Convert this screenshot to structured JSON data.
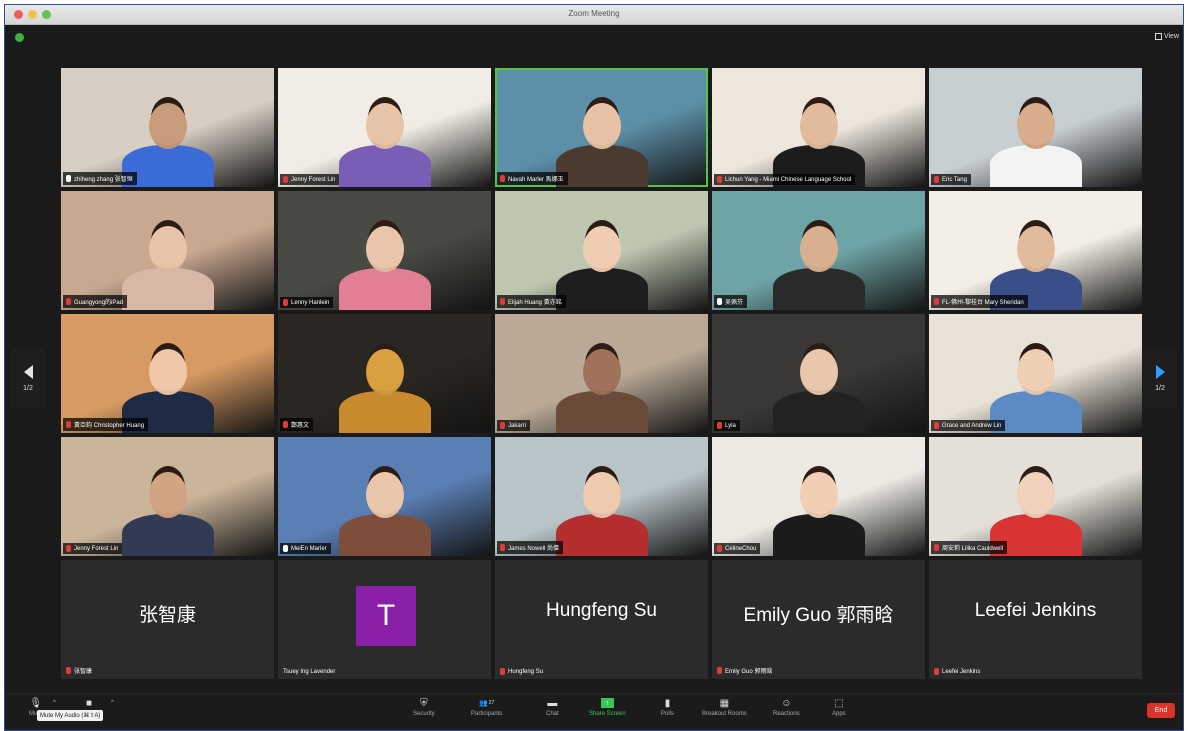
{
  "window": {
    "title": "Zoom Meeting"
  },
  "view": {
    "label": "View"
  },
  "pager": {
    "left": "1/2",
    "right": "1/2"
  },
  "participants": [
    {
      "name": "zhiheng zhang 张智恒",
      "muted": false,
      "bg": "#d8cfc4",
      "skin": "#c89b7b",
      "shirt": "#3b6bd6"
    },
    {
      "name": "Jenny Forest Lin",
      "muted": true,
      "bg": "#f1ede6",
      "skin": "#e6c4a8",
      "shirt": "#7a5db6"
    },
    {
      "name": "Navah Marler 馬娜玉",
      "muted": true,
      "bg": "#5c8fa8",
      "skin": "#e8c2a6",
      "shirt": "#4b3a2f",
      "active": true
    },
    {
      "name": "Lichun Yang - Miami Chinese Language School",
      "muted": true,
      "bg": "#ece6dc",
      "skin": "#e2bb9c",
      "shirt": "#1c1c1c"
    },
    {
      "name": "Eric Tang",
      "muted": true,
      "bg": "#c8cfd3",
      "skin": "#d9ad8b",
      "shirt": "#f3f3f3"
    },
    {
      "name": "Guangyong的iPad",
      "muted": true,
      "bg": "#c9a890",
      "skin": "#e7c3a7",
      "shirt": "#d8b7a6"
    },
    {
      "name": "Lenny Hanlein",
      "muted": true,
      "bg": "#4a4a45",
      "skin": "#eac5ab",
      "shirt": "#e27f95"
    },
    {
      "name": "Elijah Huang 黃亦銘",
      "muted": true,
      "bg": "#bdc7b0",
      "skin": "#f0cdb2",
      "shirt": "#1e1e1e"
    },
    {
      "name": "吴佩芬",
      "muted": false,
      "bg": "#6fa4a6",
      "skin": "#d8b090",
      "shirt": "#2a2a2a"
    },
    {
      "name": "FL-佛州-黎桂台 Mary Sheridan",
      "muted": true,
      "bg": "#f4efe6",
      "skin": "#e1bb9c",
      "shirt": "#3a4f8a"
    },
    {
      "name": "黃亞鈞 Christopher Huang",
      "muted": true,
      "bg": "#d79a62",
      "skin": "#f0c8a8",
      "shirt": "#1f2a44"
    },
    {
      "name": "鄭惠文",
      "muted": true,
      "bg": "#2a2622",
      "skin": "#d9a040",
      "shirt": "#c98a2e"
    },
    {
      "name": "Jakarri",
      "muted": true,
      "bg": "#b9a996",
      "skin": "#a1725a",
      "shirt": "#6b4a3a"
    },
    {
      "name": "Lyla",
      "muted": true,
      "bg": "#3a3836",
      "skin": "#e8c7ad",
      "shirt": "#222222"
    },
    {
      "name": "Grace and Andrew Lin",
      "muted": true,
      "bg": "#e9e2d6",
      "skin": "#efcfb3",
      "shirt": "#5c8ac2"
    },
    {
      "name": "Jenny Forest Lin",
      "muted": true,
      "bg": "#cbb59a",
      "skin": "#d2a481",
      "shirt": "#333a55"
    },
    {
      "name": "MeiEn Marler",
      "muted": false,
      "bg": "#5a7fb5",
      "skin": "#eac6ab",
      "shirt": "#7d4e3a"
    },
    {
      "name": "James Nowell 尚傑",
      "muted": true,
      "bg": "#b8c4c8",
      "skin": "#eecaaf",
      "shirt": "#b52f2f"
    },
    {
      "name": "CelineChou",
      "muted": true,
      "bg": "#ece9e3",
      "skin": "#f1cfb5",
      "shirt": "#1b1b1b"
    },
    {
      "name": "周安莉 Lilika Cauldwell",
      "muted": true,
      "bg": "#e4e0d8",
      "skin": "#f2d2bc",
      "shirt": "#d93434"
    }
  ],
  "no_video": [
    {
      "display": "张智康",
      "name": "张智康",
      "muted": true,
      "avatar": ""
    },
    {
      "display": "",
      "name": "Tsuey Ing Lavender",
      "muted": false,
      "avatar": "T"
    },
    {
      "display": "Hungfeng Su",
      "name": "Hungfeng Su",
      "muted": true,
      "avatar": ""
    },
    {
      "display": "Emily Guo 郭雨晗",
      "name": "Emily Guo 郭雨晗",
      "muted": true,
      "avatar": ""
    },
    {
      "display": "Leefei Jenkins",
      "name": "Leefei Jenkins",
      "muted": true,
      "avatar": ""
    }
  ],
  "toolbar": {
    "mute": "Mute",
    "tooltip": "Mute My Audio (⌘⇧A)",
    "security": "Security",
    "participants": "Participants",
    "participants_count": "27",
    "chat": "Chat",
    "share": "Share Screen",
    "polls": "Polls",
    "breakout": "Breakout Rooms",
    "reactions": "Reactions",
    "apps": "Apps",
    "end": "End"
  },
  "colors": {
    "mute_red": "#e03b3b",
    "share_green": "#3bc65a",
    "end_red": "#d9332a",
    "avatar_purple": "#8a1fa8"
  }
}
